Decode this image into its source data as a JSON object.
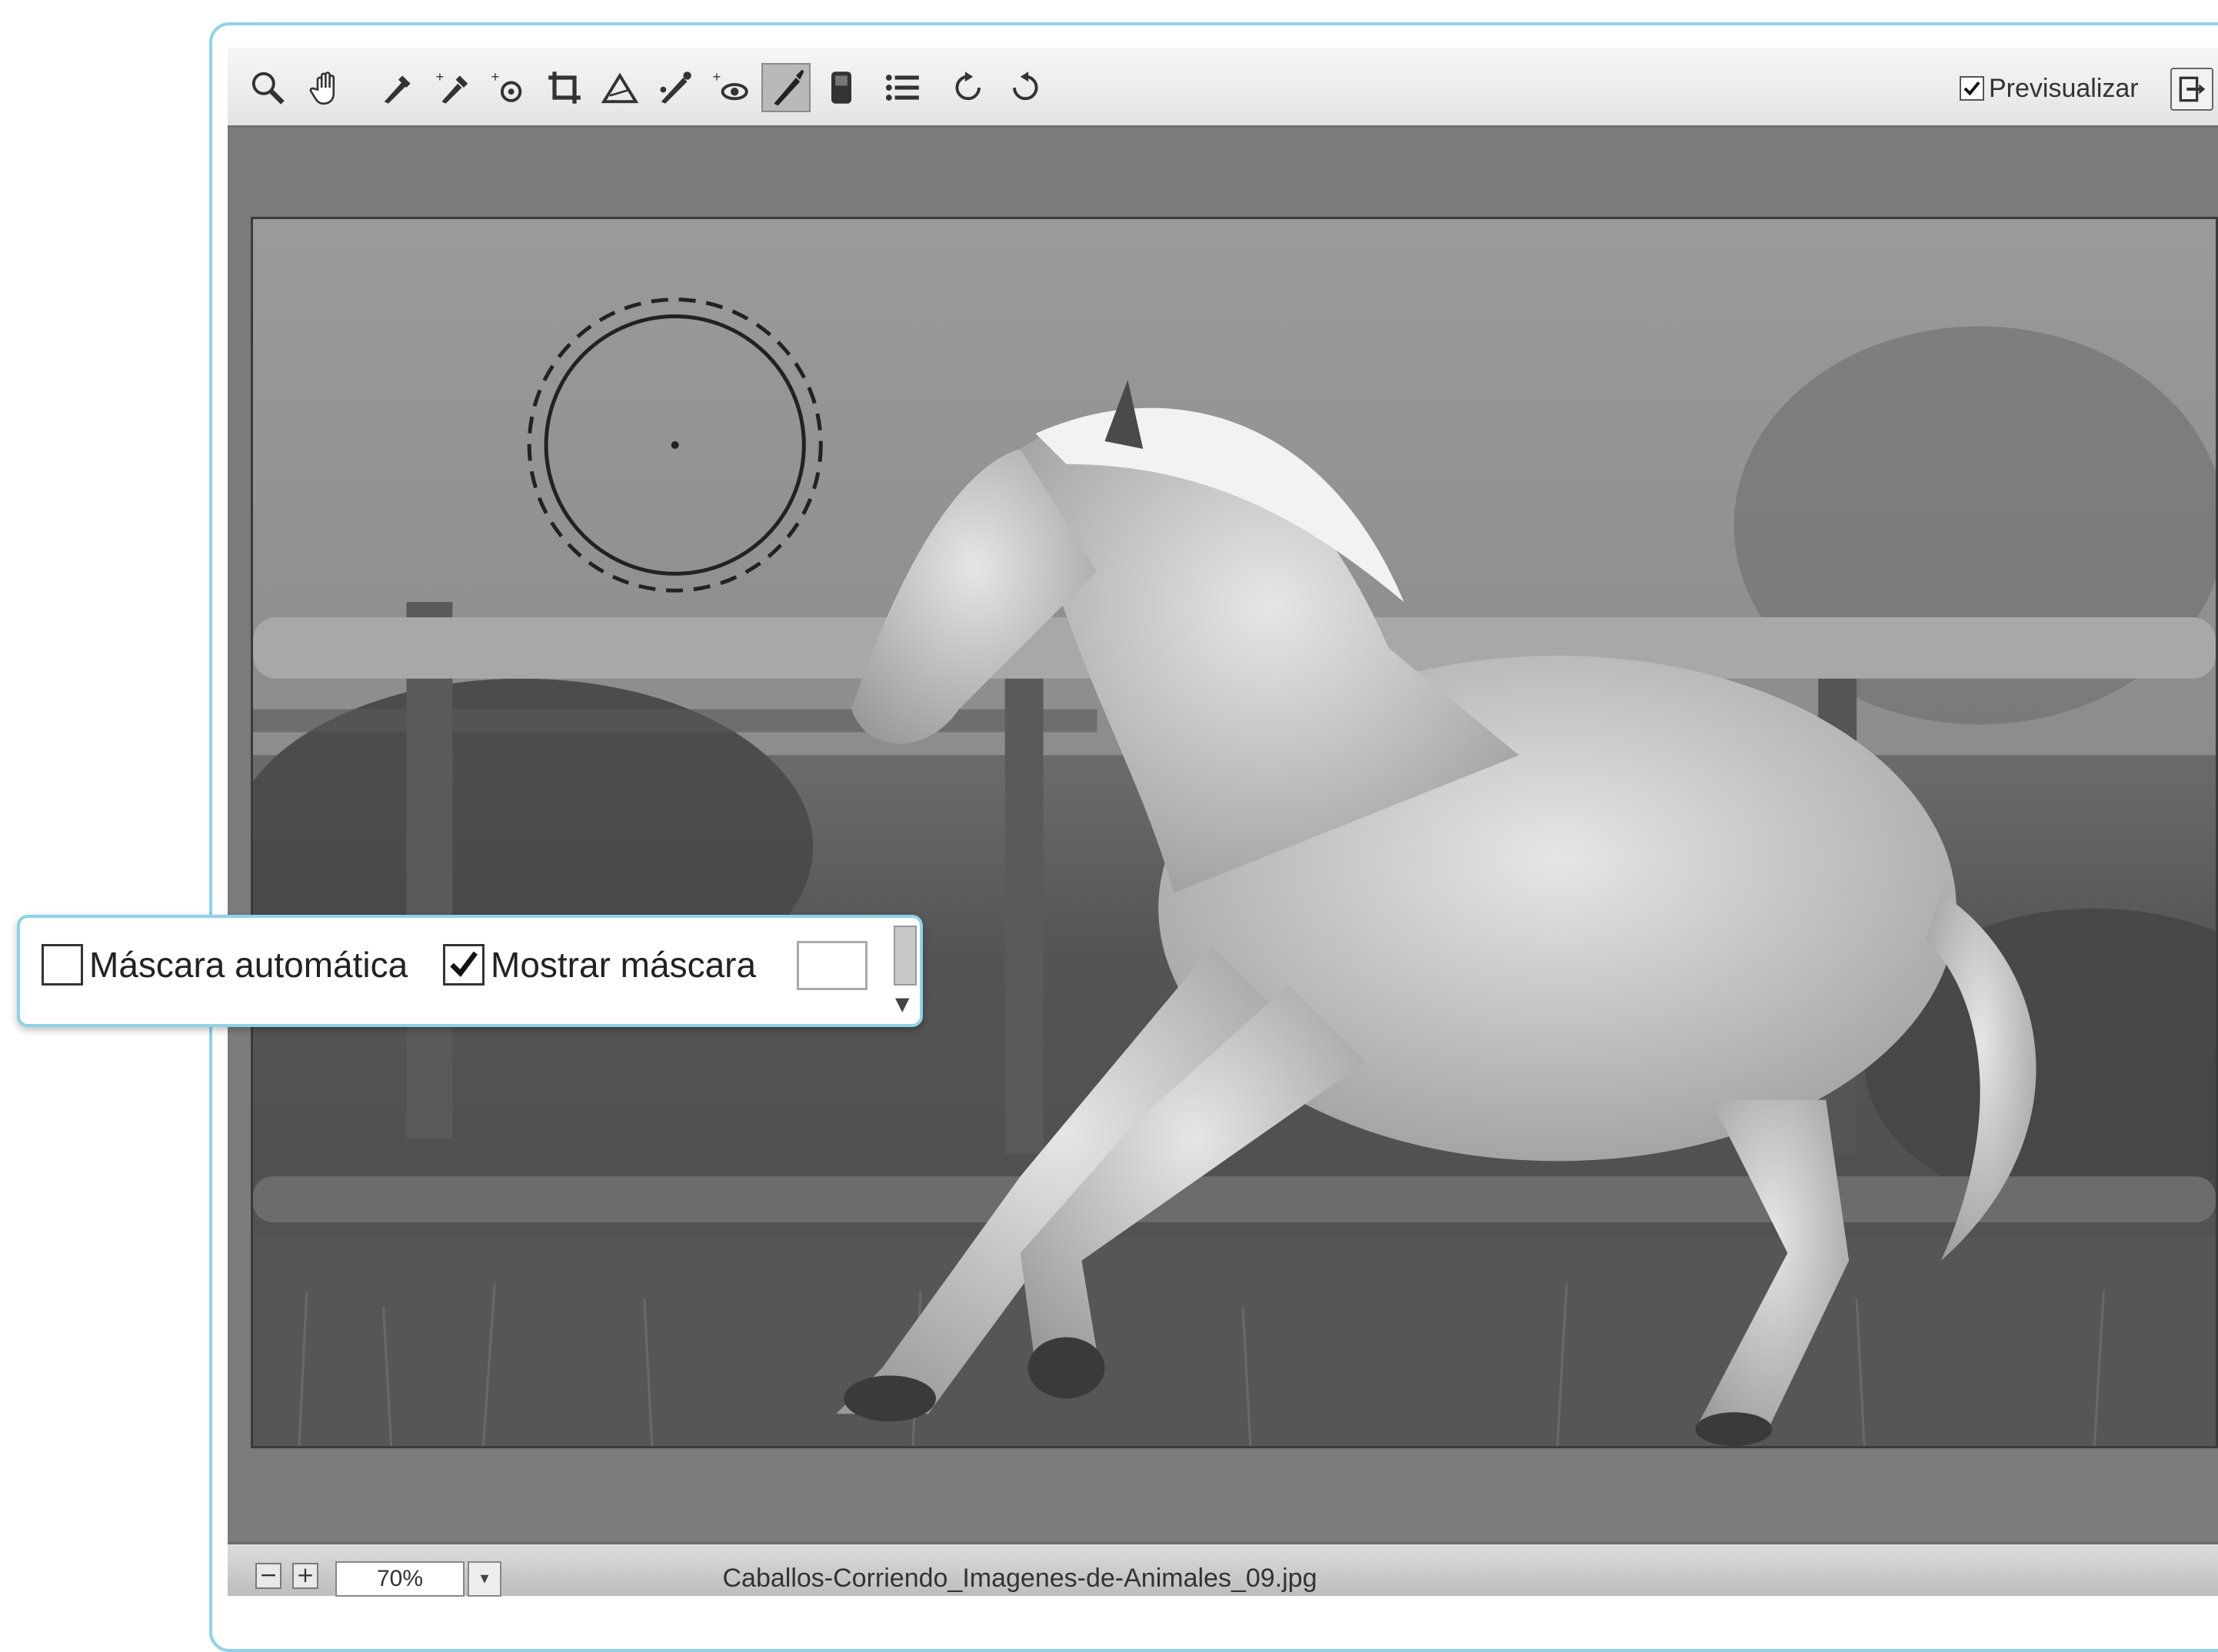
{
  "toolbar": {
    "tools": [
      {
        "name": "zoom-tool-icon"
      },
      {
        "name": "hand-tool-icon"
      },
      {
        "name": "white-balance-tool-icon"
      },
      {
        "name": "color-sampler-tool-icon"
      },
      {
        "name": "targeted-adjustment-tool-icon"
      },
      {
        "name": "crop-tool-icon"
      },
      {
        "name": "straighten-tool-icon"
      },
      {
        "name": "spot-removal-tool-icon"
      },
      {
        "name": "red-eye-removal-tool-icon"
      },
      {
        "name": "adjustment-brush-tool-icon"
      },
      {
        "name": "graduated-filter-tool-icon"
      },
      {
        "name": "preferences-icon"
      },
      {
        "name": "rotate-left-icon"
      },
      {
        "name": "rotate-right-icon"
      }
    ],
    "active_tool": "adjustment-brush-tool-icon",
    "preview_label": "Previsualizar",
    "preview_checked": true
  },
  "callout": {
    "auto_mask_label": "Máscara automática",
    "auto_mask_checked": false,
    "show_mask_label": "Mostrar máscara",
    "show_mask_checked": true,
    "mask_color": "#ffffff"
  },
  "statusbar": {
    "zoom_out": "−",
    "zoom_in": "+",
    "zoom_value": "70%",
    "filename": "Caballos-Corriendo_Imagenes-de-Animales_09.jpg"
  },
  "colors": {
    "accent": "#8fd3e8",
    "workspace": "#7b7b7b"
  }
}
